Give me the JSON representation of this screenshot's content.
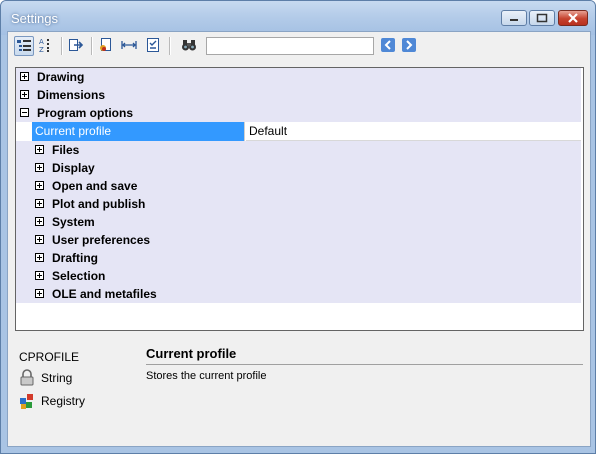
{
  "window": {
    "title": "Settings"
  },
  "toolbar": {
    "buttons": [
      "categorized-view",
      "alphabetic-view",
      "export",
      "profile",
      "dimension",
      "checklist",
      "find"
    ],
    "search_value": ""
  },
  "tree": {
    "categories": [
      {
        "label": "Drawing",
        "expanded": false
      },
      {
        "label": "Dimensions",
        "expanded": false
      },
      {
        "label": "Program options",
        "expanded": true
      }
    ],
    "selected_property": {
      "name": "Current profile",
      "value": "Default"
    },
    "subcategories": [
      "Files",
      "Display",
      "Open and save",
      "Plot and publish",
      "System",
      "User preferences",
      "Drafting",
      "Selection",
      "OLE and metafiles"
    ]
  },
  "info": {
    "command": "CPROFILE",
    "type": "String",
    "storage": "Registry",
    "title": "Current profile",
    "description": "Stores the current profile"
  },
  "colors": {
    "selection": "#3399ff",
    "row_background": "#e5e5f5",
    "frame": "#a9c4e4"
  }
}
